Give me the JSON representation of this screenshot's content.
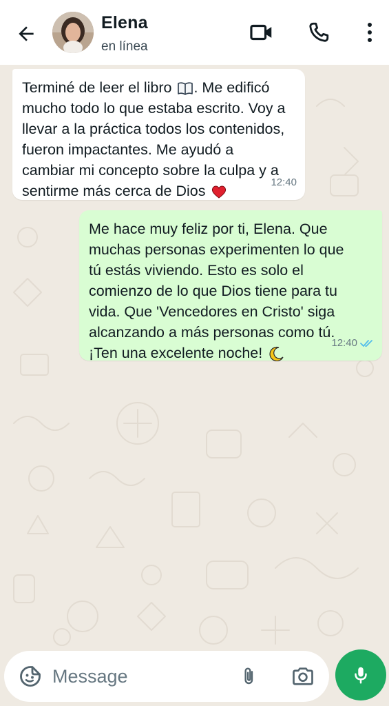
{
  "header": {
    "contact_name": "Elena",
    "status": "en línea",
    "icons": [
      "back-arrow-icon",
      "video-call-icon",
      "phone-icon",
      "more-options-icon"
    ]
  },
  "messages": [
    {
      "direction": "incoming",
      "text": "Terminé de leer el libro",
      "text_after_book": ". Me edificó\nmucho todo lo que estaba escrito. Voy a\nllevar a la práctica todos los contenidos,\nfueron impactantes. Me ayudó a\ncambiar mi concepto sobre la culpa y a\nsentirme más cerca de Dios",
      "emojis": [
        "book-emoji",
        "heart-emoji"
      ],
      "time": "12:40"
    },
    {
      "direction": "outgoing",
      "text": "Me hace muy feliz por ti, Elena. Que\nmuchas personas experimenten lo que\ntú estás viviendo. Esto es solo el\ncomienzo de lo que Dios tiene para tu\nvida. Que 'Vencedores en Cristo' siga\nalcanzando a más personas como tú.\n¡Ten una excelente noche!",
      "emojis": [
        "crescent-moon-emoji"
      ],
      "time": "12:40",
      "read_status": "read"
    }
  ],
  "composer": {
    "placeholder": "Message",
    "icons": [
      "sticker-icon",
      "attach-icon",
      "camera-icon",
      "mic-icon"
    ]
  },
  "colors": {
    "chat_background": "#efeae2",
    "outgoing_bubble": "#d9fdd3",
    "incoming_bubble": "#ffffff",
    "mic_button": "#1daa61",
    "read_ticks": "#53bdeb"
  }
}
